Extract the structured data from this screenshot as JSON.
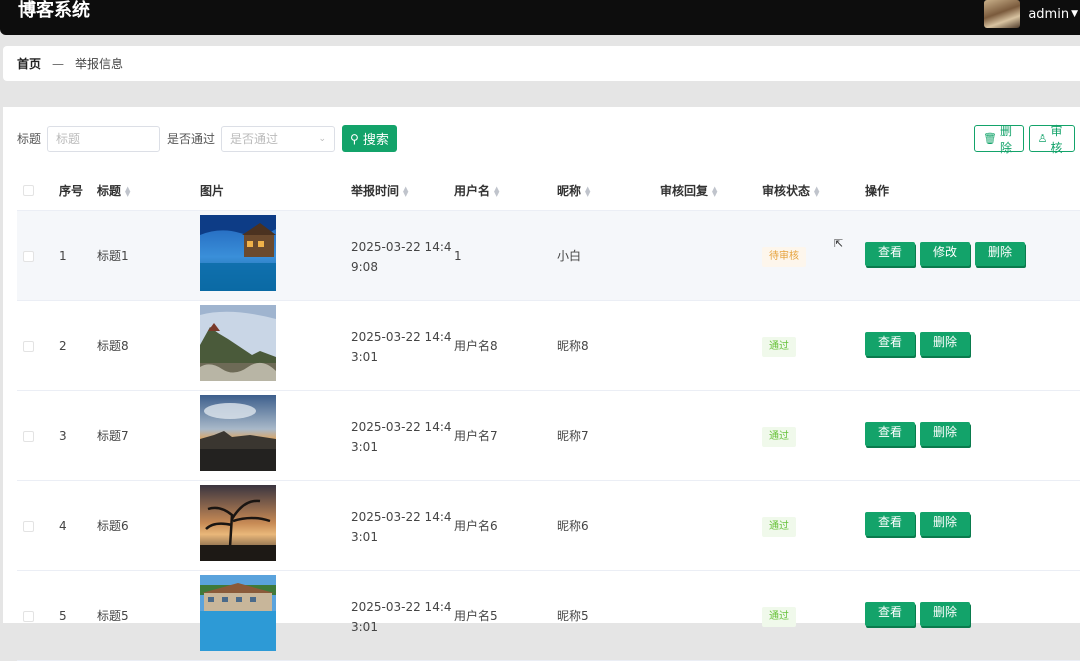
{
  "header": {
    "title": "博客系统",
    "user": "admin"
  },
  "breadcrumb": {
    "home": "首页",
    "separator": "—",
    "current": "举报信息"
  },
  "search": {
    "title_label": "标题",
    "title_placeholder": "标题",
    "pass_label": "是否通过",
    "pass_placeholder": "是否通过",
    "search_button": "搜索"
  },
  "actions": {
    "delete_button": "删除",
    "review_button": "审核"
  },
  "table": {
    "columns": [
      "序号",
      "标题",
      "图片",
      "举报时间",
      "用户名",
      "昵称",
      "审核回复",
      "审核状态",
      "操作"
    ],
    "rows": [
      {
        "index": "1",
        "title": "标题1",
        "time": "2025-03-22 14:49:08",
        "username": "1",
        "nickname": "小白",
        "reply": "",
        "status": "待审核",
        "ops": [
          "查看",
          "修改",
          "删除"
        ]
      },
      {
        "index": "2",
        "title": "标题8",
        "time": "2025-03-22 14:43:01",
        "username": "用户名8",
        "nickname": "昵称8",
        "reply": "",
        "status": "通过",
        "ops": [
          "查看",
          "删除"
        ]
      },
      {
        "index": "3",
        "title": "标题7",
        "time": "2025-03-22 14:43:01",
        "username": "用户名7",
        "nickname": "昵称7",
        "reply": "",
        "status": "通过",
        "ops": [
          "查看",
          "删除"
        ]
      },
      {
        "index": "4",
        "title": "标题6",
        "time": "2025-03-22 14:43:01",
        "username": "用户名6",
        "nickname": "昵称6",
        "reply": "",
        "status": "通过",
        "ops": [
          "查看",
          "删除"
        ]
      },
      {
        "index": "5",
        "title": "标题5",
        "time": "2025-03-22 14:43:01",
        "username": "用户名5",
        "nickname": "昵称5",
        "reply": "",
        "status": "通过",
        "ops": [
          "查看",
          "删除"
        ]
      }
    ]
  },
  "colors": {
    "accent": "#13a36a",
    "pending": "#e6a23c",
    "pass": "#67c23a",
    "topbar": "#0d0d0d"
  },
  "icons": {
    "search": "search-icon",
    "delete": "trash-icon",
    "review": "user-icon",
    "sort": "sort-icon"
  }
}
